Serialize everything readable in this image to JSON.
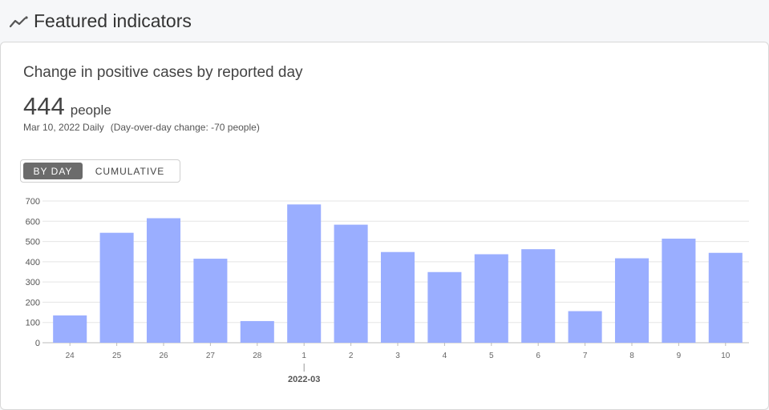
{
  "header": {
    "title": "Featured indicators",
    "icon": "trend-line-icon"
  },
  "card": {
    "title": "Change in positive cases by reported day",
    "value": "444",
    "unit": "people",
    "date": "Mar 10, 2022 Daily",
    "change": "(Day-over-day change: -70 people)"
  },
  "toggle": {
    "by_day": "BY DAY",
    "cumulative": "CUMULATIVE",
    "selected": "BY DAY"
  },
  "colors": {
    "bar": "#9aaeff",
    "grid": "#e5e5e5",
    "toggle_active": "#6b6b6b"
  },
  "chart_data": {
    "type": "bar",
    "categories": [
      "24",
      "25",
      "26",
      "27",
      "28",
      "1",
      "2",
      "3",
      "4",
      "5",
      "6",
      "7",
      "8",
      "9",
      "10"
    ],
    "values": [
      135,
      543,
      615,
      415,
      107,
      683,
      583,
      448,
      349,
      437,
      462,
      156,
      417,
      514,
      444
    ],
    "month_marker": {
      "category": "1",
      "label": "2022-03"
    },
    "ylim": [
      0,
      700
    ],
    "yticks": [
      0,
      100,
      200,
      300,
      400,
      500,
      600,
      700
    ],
    "grid": true
  }
}
